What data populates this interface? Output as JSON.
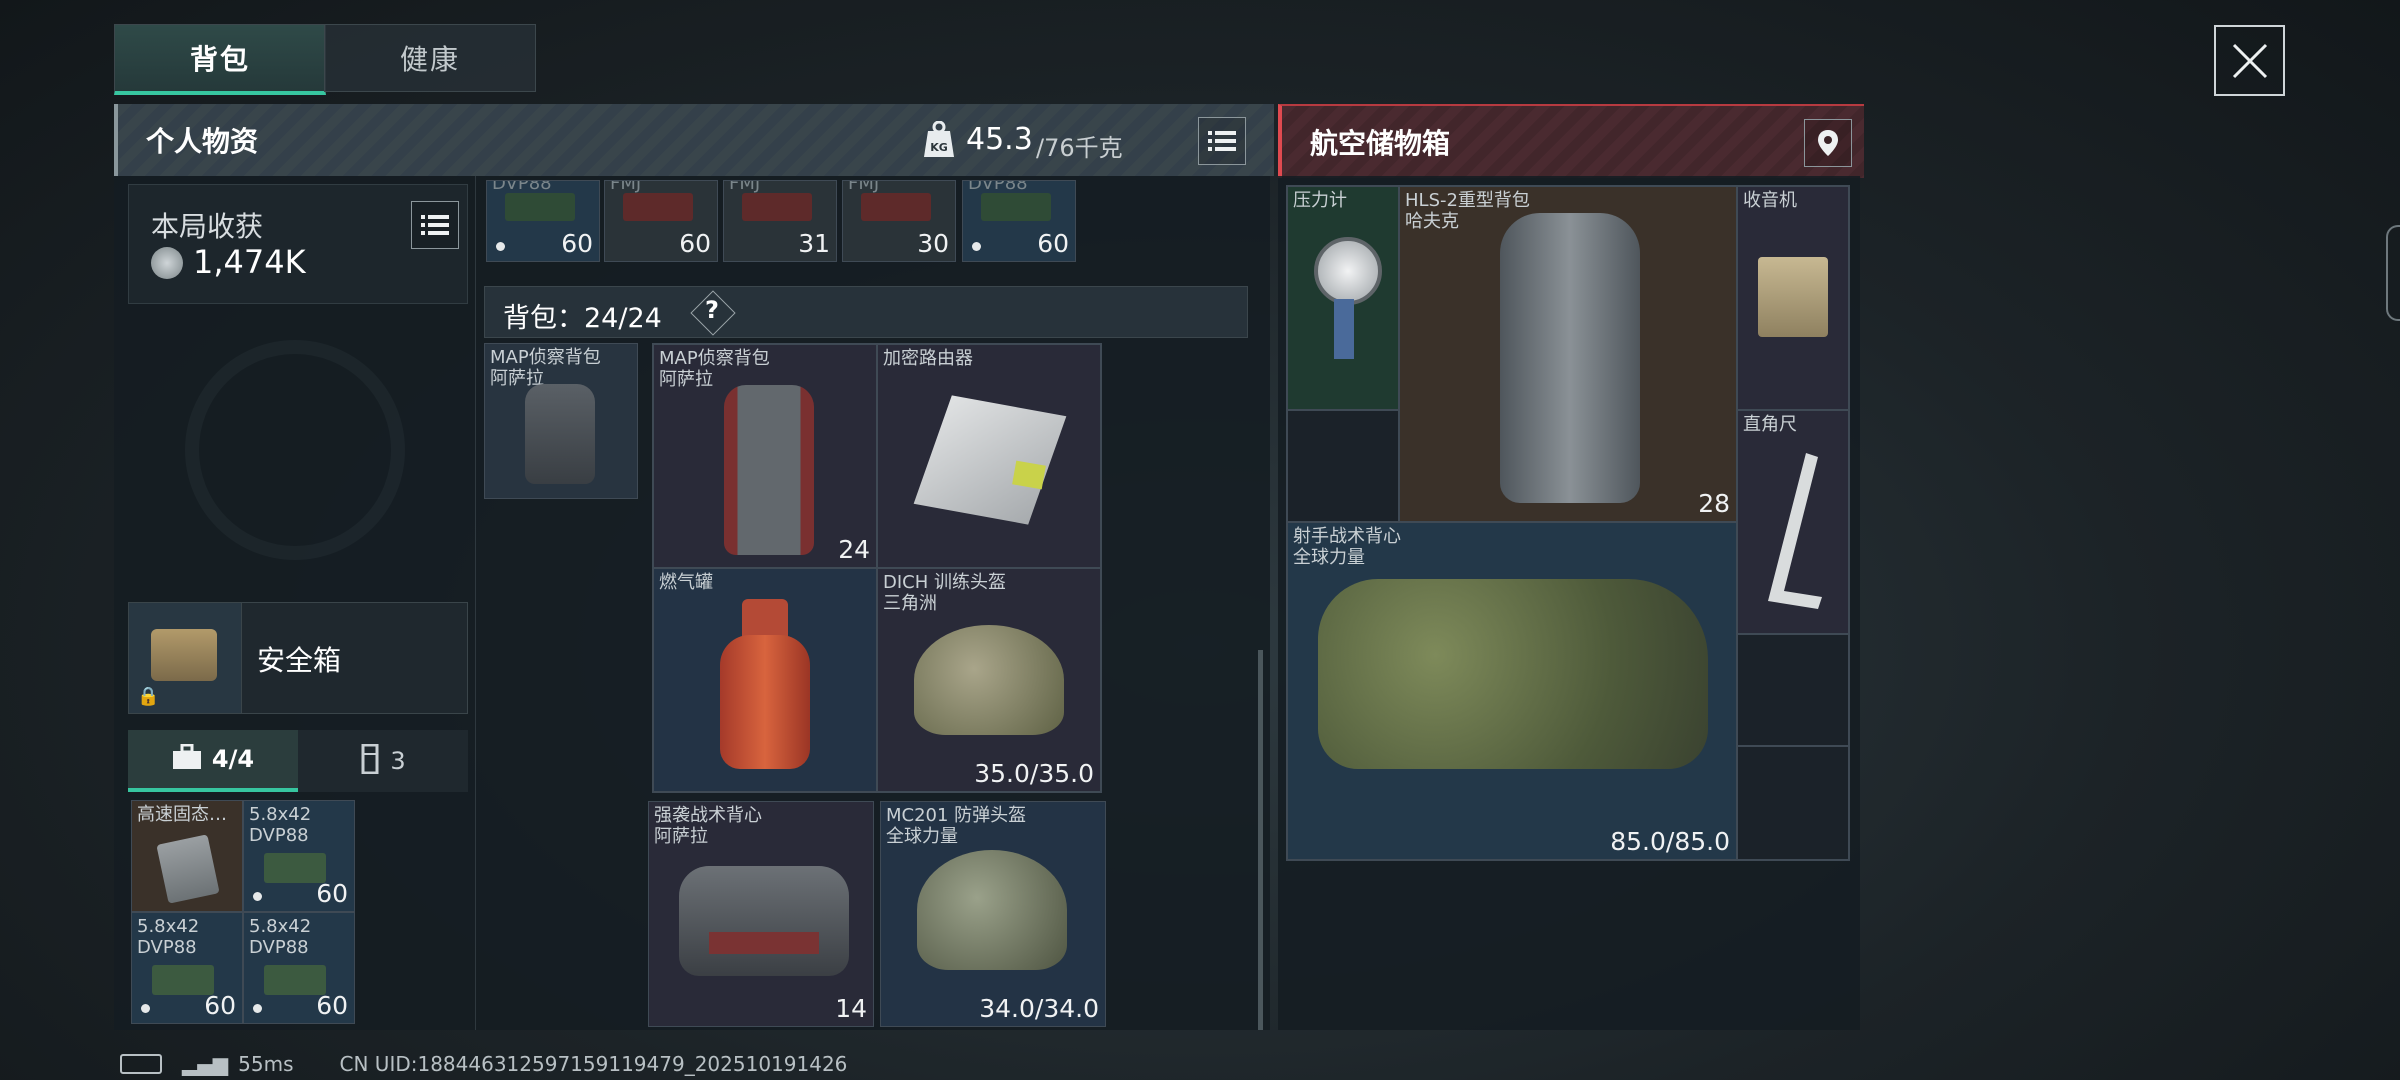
{
  "tabs": {
    "backpack": "背包",
    "health": "健康"
  },
  "personal": {
    "title": "个人物资",
    "weight": "45.3",
    "weight_max": "/76千克",
    "weight_icon": "kg-weight-icon"
  },
  "air_box": {
    "title": "航空储物箱"
  },
  "harvest": {
    "label": "本局收获",
    "value": "1,474K"
  },
  "safe_box": {
    "label": "安全箱"
  },
  "mini_tabs": {
    "kit": "4/4",
    "mag": "3"
  },
  "safe_items": [
    {
      "name": "高速固态…",
      "count": ""
    },
    {
      "name": "5.8x42\nDVP88",
      "count": "60"
    },
    {
      "name": "5.8x42\nDVP88",
      "count": "60"
    },
    {
      "name": "5.8x42\nDVP88",
      "count": "60"
    }
  ],
  "top_strip": [
    {
      "name": "DVP88",
      "count": "60",
      "color": "#2f4b36"
    },
    {
      "name": "FMJ",
      "count": "60",
      "color": "#5e2a2a"
    },
    {
      "name": "FMJ",
      "count": "31",
      "color": "#5e2a2a"
    },
    {
      "name": "FMJ",
      "count": "30",
      "color": "#5e2a2a"
    },
    {
      "name": "DVP88",
      "count": "60",
      "color": "#2f4b36"
    }
  ],
  "backpack_label": "背包：24/24",
  "backpack_help": "?",
  "items": {
    "map_small": {
      "name": "MAP侦察背包",
      "sub": "阿萨拉"
    },
    "map_big": {
      "name": "MAP侦察背包",
      "sub": "阿萨拉",
      "count": "24"
    },
    "router": {
      "name": "加密路由器",
      "sub": ""
    },
    "gas": {
      "name": "燃气罐",
      "sub": ""
    },
    "dich": {
      "name": "DICH 训练头盔",
      "sub": "三角洲",
      "durability": "35.0/35.0"
    },
    "vest": {
      "name": "强袭战术背心",
      "sub": "阿萨拉",
      "count": "14"
    },
    "mc201": {
      "name": "MC201 防弹头盔",
      "sub": "全球力量",
      "durability": "34.0/34.0"
    }
  },
  "air_items": {
    "gauge": {
      "name": "压力计"
    },
    "hls": {
      "name": "HLS-2重型背包",
      "sub": "哈夫克",
      "count": "28"
    },
    "radio": {
      "name": "收音机"
    },
    "square": {
      "name": "直角尺"
    },
    "sniper_vest": {
      "name": "射手战术背心",
      "sub": "全球力量",
      "durability": "85.0/85.0"
    }
  },
  "status": {
    "ping": "55ms",
    "uid": "CN UID:18844631259715911947​9_202510191426"
  }
}
